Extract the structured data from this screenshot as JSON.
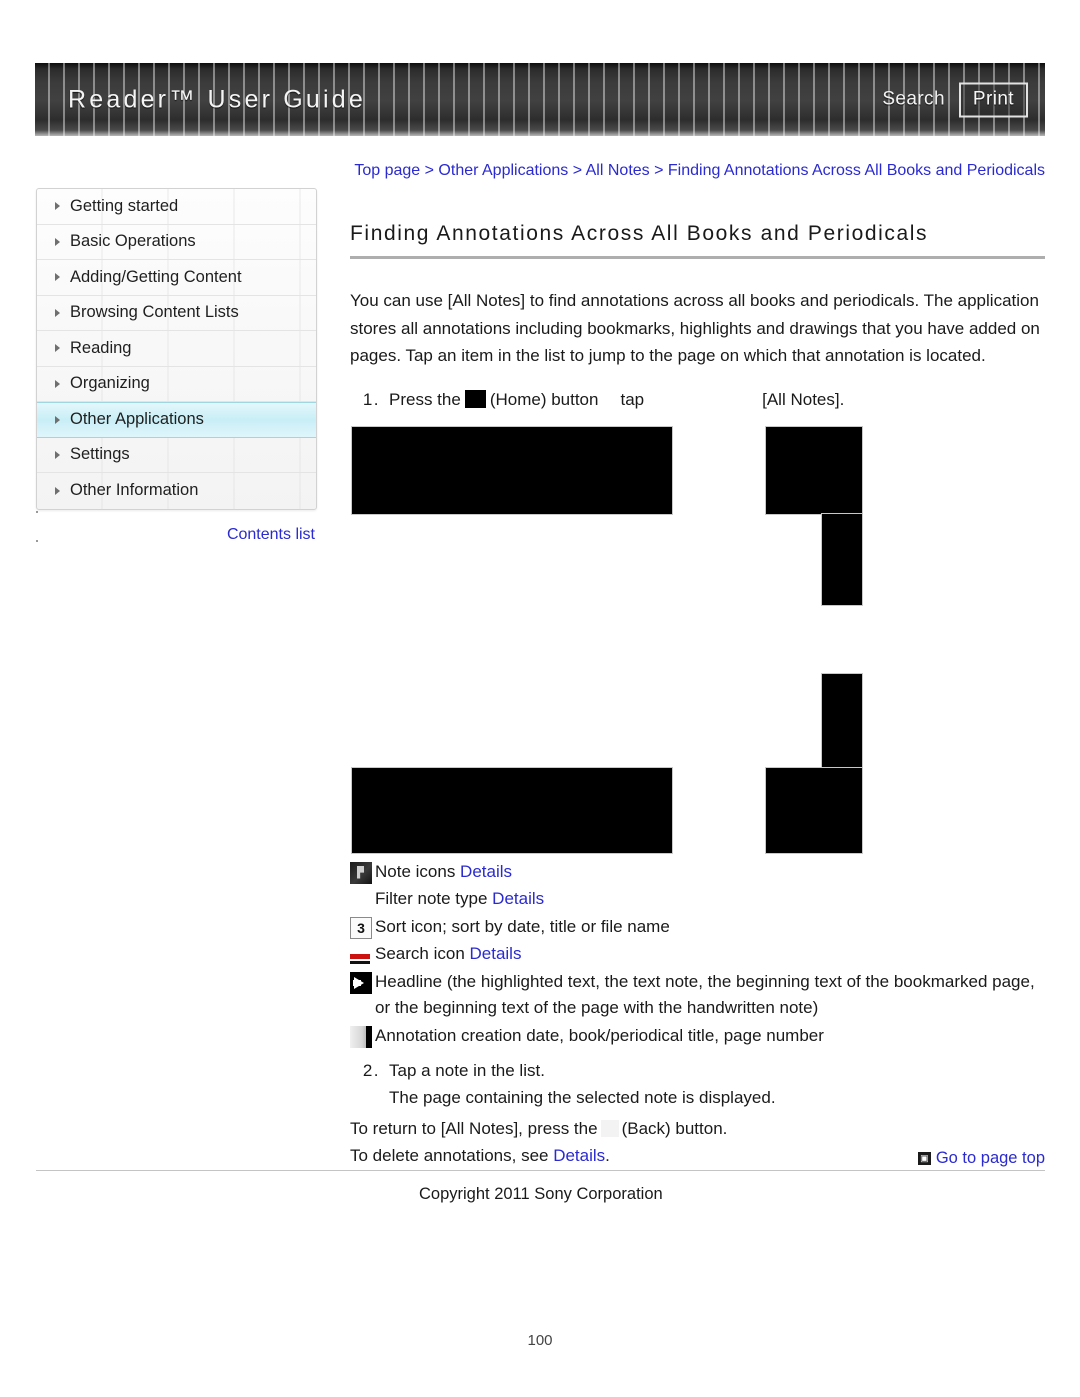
{
  "header": {
    "title": "Reader™ User Guide",
    "search_label": "Search",
    "print_label": "Print"
  },
  "sidebar": {
    "items": [
      {
        "label": "Getting started",
        "active": false
      },
      {
        "label": "Basic Operations",
        "active": false
      },
      {
        "label": "Adding/Getting Content",
        "active": false
      },
      {
        "label": "Browsing Content Lists",
        "active": false
      },
      {
        "label": "Reading",
        "active": false
      },
      {
        "label": "Organizing",
        "active": false
      },
      {
        "label": "Other Applications",
        "active": true
      },
      {
        "label": "Settings",
        "active": false
      },
      {
        "label": "Other Information",
        "active": false
      }
    ],
    "contents_list_label": "Contents list"
  },
  "breadcrumb": {
    "text": "Top page > Other Applications > All Notes > Finding Annotations Across All Books and Periodicals"
  },
  "main": {
    "page_title": "Finding Annotations Across All Books and Periodicals",
    "intro": "You can use [All Notes] to find annotations across all books and periodicals. The application stores all annotations including bookmarks, highlights and drawings that you have added on pages. Tap an item in the list to jump to the page on which that annotation is located.",
    "step1": {
      "number": "1.",
      "text_before_icon": "Press the",
      "text_after_icon": "(Home) button",
      "text_tap": "tap",
      "text_end": "[All Notes]."
    },
    "legend": [
      {
        "icon": "note-icons-icon",
        "text": "Note icons ",
        "link": "Details",
        "text_after": ""
      },
      {
        "icon": "none",
        "text": "Filter note type ",
        "link": "Details",
        "text_after": ""
      },
      {
        "icon": "sort-icon",
        "icon_label": "3",
        "text": "Sort icon; sort by date, title or file name",
        "link": "",
        "text_after": ""
      },
      {
        "icon": "search-icon",
        "text": "Search icon ",
        "link": "Details",
        "text_after": ""
      },
      {
        "icon": "headline-arrow-icon",
        "text": "Headline (the highlighted text, the text note, the beginning text of the bookmarked page, or the beginning text of the page with the handwritten note)",
        "link": "",
        "text_after": ""
      },
      {
        "icon": "annotation-bar-icon",
        "text": "Annotation creation date, book/periodical title, page number",
        "link": "",
        "text_after": ""
      }
    ],
    "step2": {
      "number": "2.",
      "text": "Tap a note in the list.",
      "sub_text": "The page containing the selected note is displayed."
    },
    "return_line_before": "To return to [All Notes], press the",
    "return_line_after": "(Back) button.",
    "delete_line_before": "To delete annotations, see ",
    "delete_line_link": "Details",
    "delete_line_after": "."
  },
  "footer": {
    "goto_top_label": "Go to page top",
    "goto_top_icon_glyph": "▣",
    "copyright": "Copyright 2011 Sony Corporation",
    "page_number": "100"
  },
  "colors": {
    "link": "#2a2ad0",
    "active_nav": "#c9eef6",
    "banner": "#414141"
  }
}
